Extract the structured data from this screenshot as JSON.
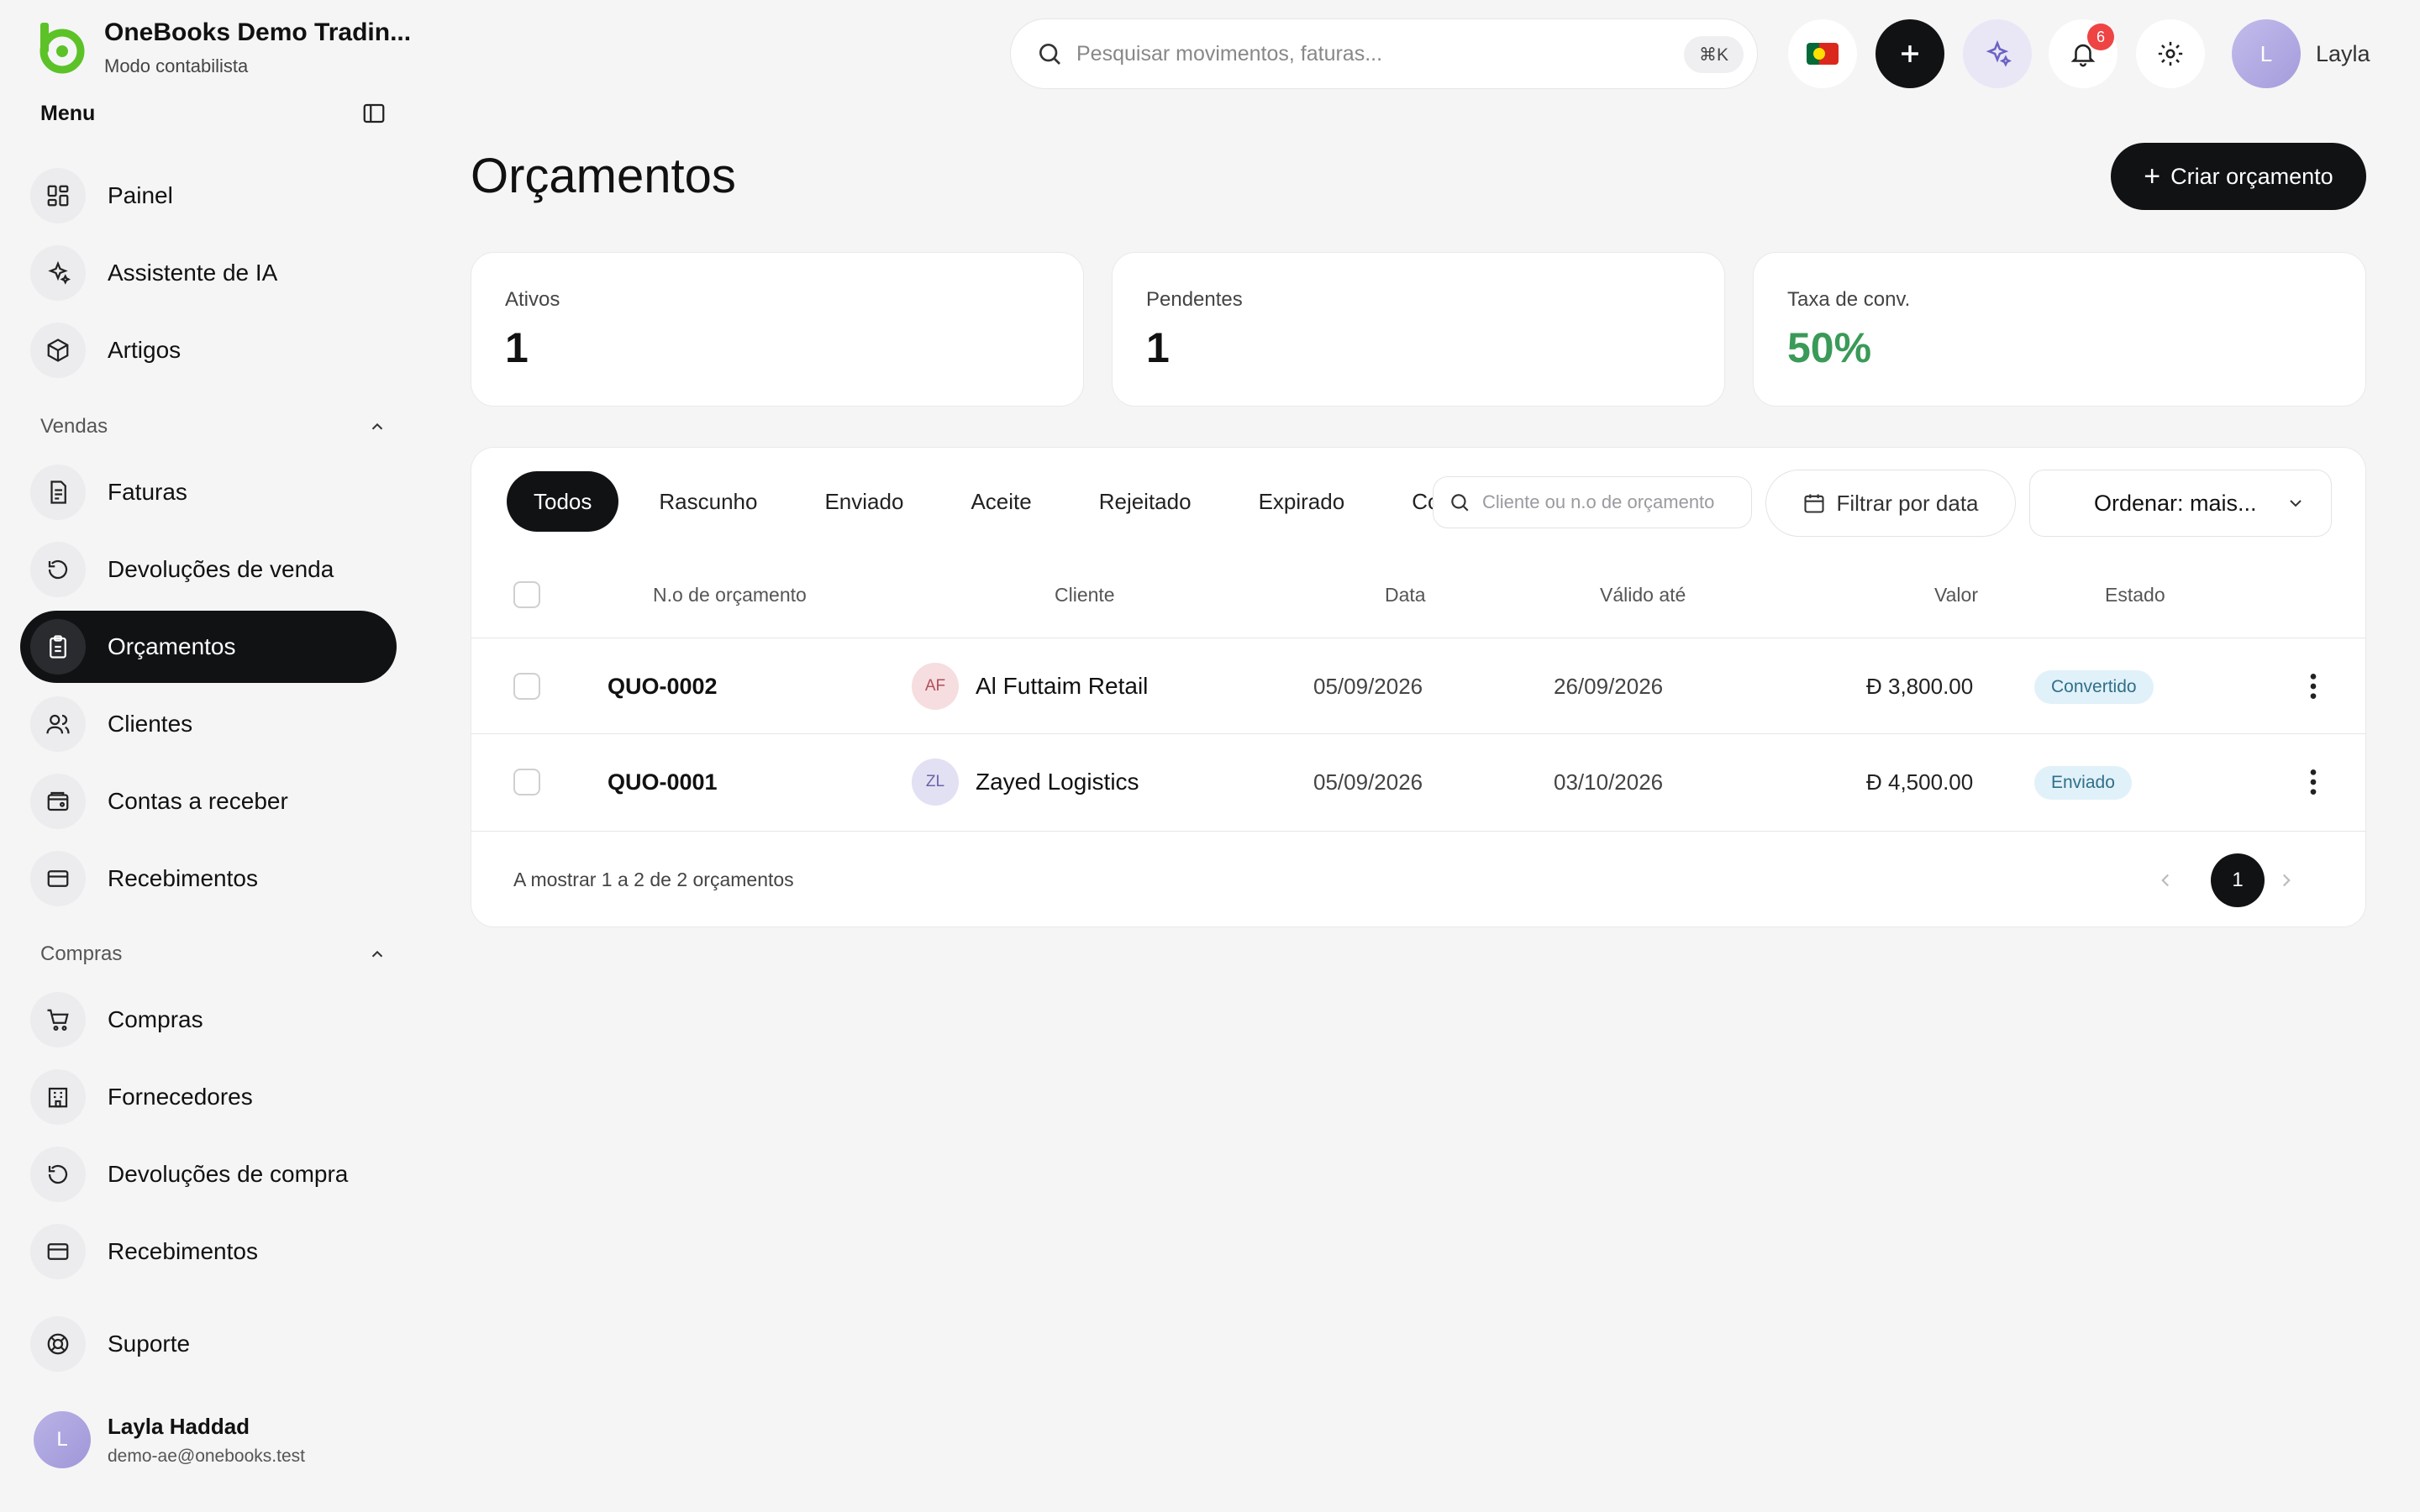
{
  "brand": {
    "title": "OneBooks Demo Tradin...",
    "subtitle": "Modo contabilista",
    "accent": "#5cc228"
  },
  "sidebar": {
    "menu_label": "Menu",
    "top_items": [
      {
        "label": "Painel",
        "icon": "dashboard-icon"
      },
      {
        "label": "Assistente de IA",
        "icon": "sparkles-icon"
      },
      {
        "label": "Artigos",
        "icon": "package-icon"
      }
    ],
    "sales_section": "Vendas",
    "sales_items": [
      {
        "label": "Faturas",
        "icon": "invoice-icon"
      },
      {
        "label": "Devoluções de venda",
        "icon": "return-icon"
      },
      {
        "label": "Orçamentos",
        "icon": "clipboard-icon",
        "active": true
      },
      {
        "label": "Clientes",
        "icon": "users-icon"
      },
      {
        "label": "Contas a receber",
        "icon": "wallet-icon"
      },
      {
        "label": "Recebimentos",
        "icon": "card-icon"
      }
    ],
    "purchases_section": "Compras",
    "purchase_items": [
      {
        "label": "Compras",
        "icon": "cart-icon"
      },
      {
        "label": "Fornecedores",
        "icon": "building-icon"
      },
      {
        "label": "Devoluções de compra",
        "icon": "return-icon"
      },
      {
        "label": "Recebimentos",
        "icon": "card-icon"
      }
    ],
    "support": {
      "label": "Suporte",
      "icon": "lifebuoy-icon"
    },
    "user": {
      "initial": "L",
      "name": "Layla Haddad",
      "email": "demo-ae@onebooks.test"
    }
  },
  "topbar": {
    "search_placeholder": "Pesquisar movimentos, faturas...",
    "shortcut": "⌘K",
    "notifications_count": "6",
    "user_initial": "L",
    "user_name": "Layla"
  },
  "page": {
    "title": "Orçamentos",
    "create_button": "Criar orçamento"
  },
  "stats": [
    {
      "label": "Ativos",
      "value": "1"
    },
    {
      "label": "Pendentes",
      "value": "1"
    },
    {
      "label": "Taxa de conv.",
      "value": "50%",
      "color": "#3a9a58"
    }
  ],
  "filters": {
    "tabs": [
      "Todos",
      "Rascunho",
      "Enviado",
      "Aceite",
      "Rejeitado",
      "Expirado",
      "Convertido"
    ],
    "active_tab": "Todos",
    "search_placeholder": "Cliente ou n.o de orçamento",
    "date_filter": "Filtrar por data",
    "sort_label": "Ordenar: mais..."
  },
  "table": {
    "columns": [
      "N.o de orçamento",
      "Cliente",
      "Data",
      "Válido até",
      "Valor",
      "Estado"
    ],
    "rows": [
      {
        "number": "QUO-0002",
        "initials": "AF",
        "customer": "Al Futtaim Retail",
        "date": "05/09/2026",
        "valid_until": "26/09/2026",
        "value": "Ð 3,800.00",
        "status": "Convertido"
      },
      {
        "number": "QUO-0001",
        "initials": "ZL",
        "customer": "Zayed Logistics",
        "date": "05/09/2026",
        "valid_until": "03/10/2026",
        "value": "Ð 4,500.00",
        "status": "Enviado"
      }
    ],
    "footer_info": "A mostrar 1 a 2 de 2 orçamentos",
    "current_page": "1"
  }
}
